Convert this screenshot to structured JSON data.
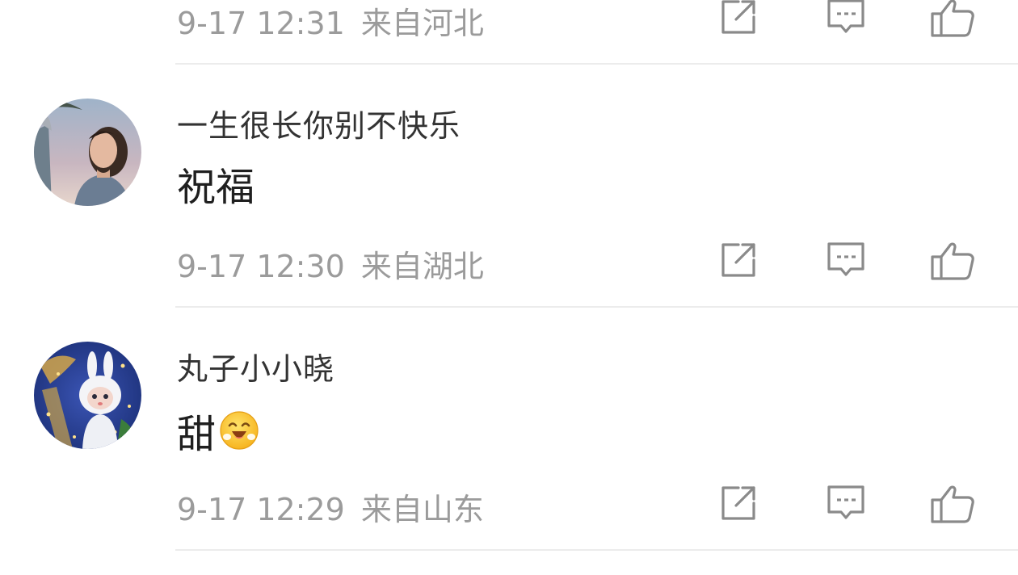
{
  "comments": [
    {
      "time": "9-17 12:31",
      "location": "来自河北"
    },
    {
      "username": "一生很长你别不快乐",
      "content": "祝福",
      "time": "9-17 12:30",
      "location": "来自湖北",
      "avatar_icon": "woman-portrait-avatar"
    },
    {
      "username": "丸子小小晓",
      "content": "甜",
      "content_emoji": "smiling-face-emoji",
      "time": "9-17 12:29",
      "location": "来自山东",
      "avatar_icon": "white-bunny-figure-avatar"
    }
  ],
  "actions": {
    "share_icon": "share-icon",
    "reply_icon": "comment-icon",
    "like_icon": "thumbs-up-icon"
  },
  "colors": {
    "meta_text": "#9b9b9b",
    "username_text": "#333333",
    "content_text": "#1f1f1f",
    "icon_stroke": "#8a8a8a",
    "divider": "#ececec"
  }
}
